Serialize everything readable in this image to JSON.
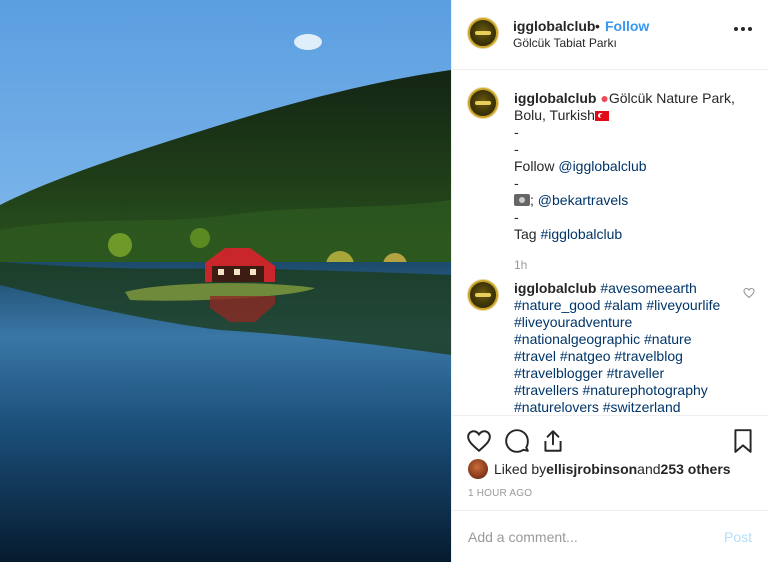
{
  "post": {
    "username": "igglobalclub",
    "dot": "•",
    "follow_label": "Follow",
    "location": "Gölcük Tabiat Parkı"
  },
  "caption": {
    "username": "igglobalclub",
    "line1": "Gölcük Nature Park,",
    "line2": "Bolu, Turkish",
    "dash": "-",
    "follow_prefix": "Follow ",
    "follow_handle": "@igglobalclub",
    "camera_suffix": "; ",
    "photo_handle": "@bekartravels",
    "tag_prefix": "Tag ",
    "tag_hashtag": "#igglobalclub",
    "time": "1h"
  },
  "comment": {
    "username": "igglobalclub",
    "lines": [
      "#avesomeearth",
      "#nature_good #alam #liveyourlife",
      "#liveyouradventure",
      "#nationalgeographic #nature",
      "#travel #natgeo #travelblog",
      "#travelblogger #traveller",
      "#travellers #naturephotography",
      "#naturelovers #switzerland"
    ]
  },
  "likes": {
    "prefix": "Liked by ",
    "user": "ellisjrobinson",
    "middle": " and ",
    "count": "253 others"
  },
  "posted_time": "1 HOUR AGO",
  "comment_box": {
    "placeholder": "Add a comment...",
    "post_label": "Post"
  },
  "colors": {
    "link_blue": "#3897f0",
    "hashtag": "#003569",
    "post_disabled": "#b2dffc",
    "muted": "#999999"
  },
  "icons": [
    "heart-icon",
    "comment-icon",
    "share-icon",
    "bookmark-icon",
    "more-icon",
    "location-pin-icon",
    "camera-icon",
    "turkey-flag-icon"
  ]
}
